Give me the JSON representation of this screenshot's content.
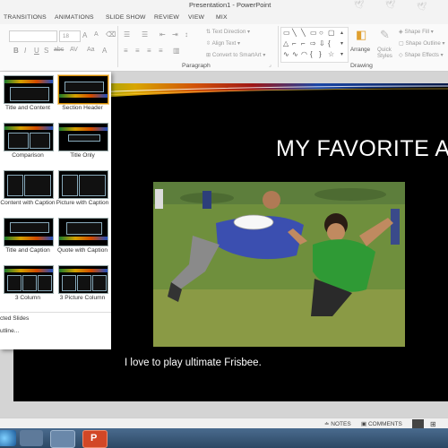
{
  "window": {
    "title": "Presentation1 - PowerPoint"
  },
  "tabs": [
    "TRANSITIONS",
    "ANIMATIONS",
    "SLIDE SHOW",
    "REVIEW",
    "VIEW",
    "MIX"
  ],
  "ribbon": {
    "font_size": "18",
    "paragraph_group_label": "Paragraph",
    "drawing_group_label": "Drawing",
    "text_direction": "Text Direction",
    "align_text": "Align Text",
    "convert_smartart": "Convert to SmartArt",
    "arrange": "Arrange",
    "quick_styles": "Quick Styles",
    "shape_fill": "Shape Fill",
    "shape_outline": "Shape Outline",
    "shape_effects": "Shape Effects",
    "font_buttons": [
      "B",
      "I",
      "U",
      "S",
      "abc",
      "AV",
      "Aa",
      "A"
    ]
  },
  "layout_gallery": {
    "layouts": [
      {
        "label": "Title and Content",
        "selected": false
      },
      {
        "label": "Section Header",
        "selected": true
      },
      {
        "label": "Comparison",
        "selected": false
      },
      {
        "label": "Title Only",
        "selected": false
      },
      {
        "label": "Content with Caption",
        "selected": false
      },
      {
        "label": "Picture with Caption",
        "selected": false
      },
      {
        "label": "Title and Caption",
        "selected": false
      },
      {
        "label": "Quote with Caption",
        "selected": false
      },
      {
        "label": "3 Column",
        "selected": false
      },
      {
        "label": "3 Picture Column",
        "selected": false
      }
    ],
    "menu": [
      "cted Slides",
      "utline..."
    ]
  },
  "slide": {
    "title": "MY FAVORITE A",
    "caption": "I love to play ultimate Frisbee."
  },
  "statusbar": {
    "notes": "NOTES",
    "comments": "COMMENTS"
  },
  "colors": {
    "accent_orange": "#d24726",
    "slide_bg": "#000000",
    "ribbon_bg": "#fafafa"
  }
}
